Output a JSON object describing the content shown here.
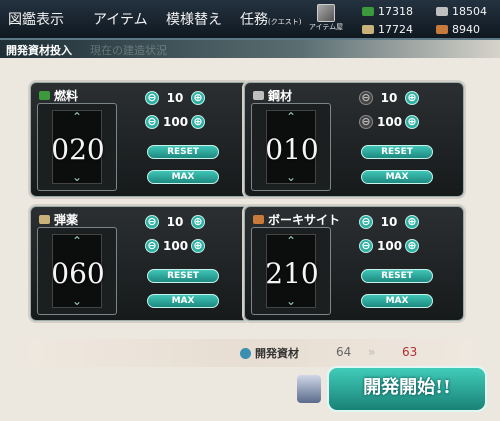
{
  "menu": [
    {
      "label": "図鑑表示"
    },
    {
      "label": "アイテム"
    },
    {
      "label": "模様替え"
    },
    {
      "label": "任務",
      "sub": "(クエスト)"
    }
  ],
  "shop": {
    "label": "アイテム屋"
  },
  "resources": {
    "fuel": "17318",
    "ammo": "17724",
    "steel": "18504",
    "bauxite": "8940"
  },
  "banner": {
    "title": "開発資材投入",
    "ghost": "現在の建造状況"
  },
  "cards": [
    {
      "name": "燃料",
      "value": "020",
      "step1": "10",
      "step2": "100",
      "reset": "RESET",
      "max": "MAX"
    },
    {
      "name": "鋼材",
      "value": "010",
      "step1": "10",
      "step2": "100",
      "reset": "RESET",
      "max": "MAX"
    },
    {
      "name": "弾薬",
      "value": "060",
      "step1": "10",
      "step2": "100",
      "reset": "RESET",
      "max": "MAX"
    },
    {
      "name": "ボーキサイト",
      "value": "210",
      "step1": "10",
      "step2": "100",
      "reset": "RESET",
      "max": "MAX"
    }
  ],
  "materials": {
    "label": "開発資材",
    "current": "64",
    "after": "63"
  },
  "start": {
    "label": "開発開始!!"
  },
  "colors": {
    "accent": "#2fb0a4",
    "fuel": "#3c9a3c",
    "ammo": "#c8b27a",
    "steel": "#bfbfbf",
    "bauxite": "#c87a3a",
    "after": "#b03030"
  },
  "icons": {
    "plus": "⊕",
    "minus": "⊖",
    "up": "⌃",
    "down": "⌄",
    "chevron": "»"
  }
}
